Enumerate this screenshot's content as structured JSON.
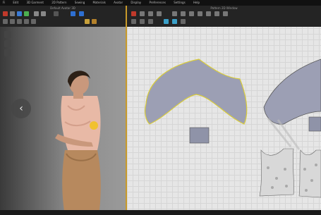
{
  "menu": [
    "Fi",
    "Edit",
    "3D Garment",
    "2D Pattern",
    "Sewing",
    "Materials",
    "Avatar",
    "Display",
    "Preferences",
    "Settings",
    "Help"
  ],
  "left_view_title": "Default Avatar 3D",
  "right_view_title": "Pattern 2D Window",
  "nav_arrow": "‹",
  "colors": {
    "accent": "#c89a2a",
    "pattern_fill": "#9c9fb4",
    "pattern_edge": "#d9cc3a"
  }
}
